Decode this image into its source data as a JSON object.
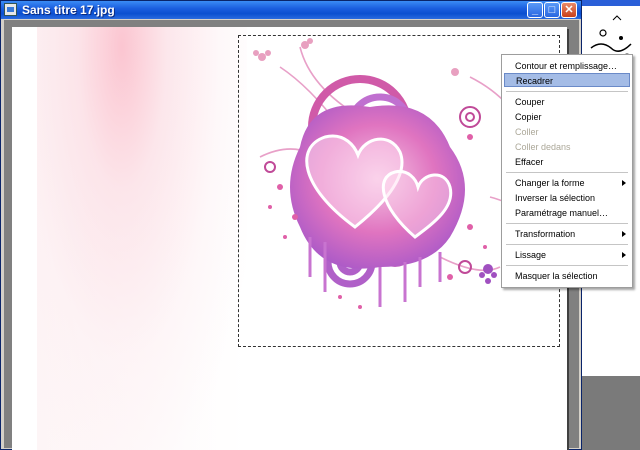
{
  "window": {
    "title": "Sans titre 17.jpg"
  },
  "controls": {
    "minimize": "minimize-icon",
    "maximize": "maximize-icon",
    "close": "close-icon"
  },
  "menu": {
    "items": [
      {
        "label": "Contour et remplissage…",
        "state": "normal"
      },
      {
        "label": "Recadrer",
        "state": "highlighted"
      },
      {
        "label": "Couper",
        "state": "normal"
      },
      {
        "label": "Copier",
        "state": "normal"
      },
      {
        "label": "Coller",
        "state": "disabled"
      },
      {
        "label": "Coller dedans",
        "state": "disabled"
      },
      {
        "label": "Effacer",
        "state": "normal"
      },
      {
        "label": "Changer la forme",
        "state": "normal",
        "submenu": true
      },
      {
        "label": "Inverser la sélection",
        "state": "normal"
      },
      {
        "label": "Paramétrage manuel…",
        "state": "normal"
      },
      {
        "label": "Transformation",
        "state": "normal",
        "submenu": true
      },
      {
        "label": "Lissage",
        "state": "normal",
        "submenu": true
      },
      {
        "label": "Masquer la sélection",
        "state": "normal"
      }
    ]
  },
  "colors": {
    "title_bar": "#0a4fd0",
    "highlight": "#a4bce6",
    "art_pink": "#e066b0",
    "art_purple": "#b05ad0"
  }
}
